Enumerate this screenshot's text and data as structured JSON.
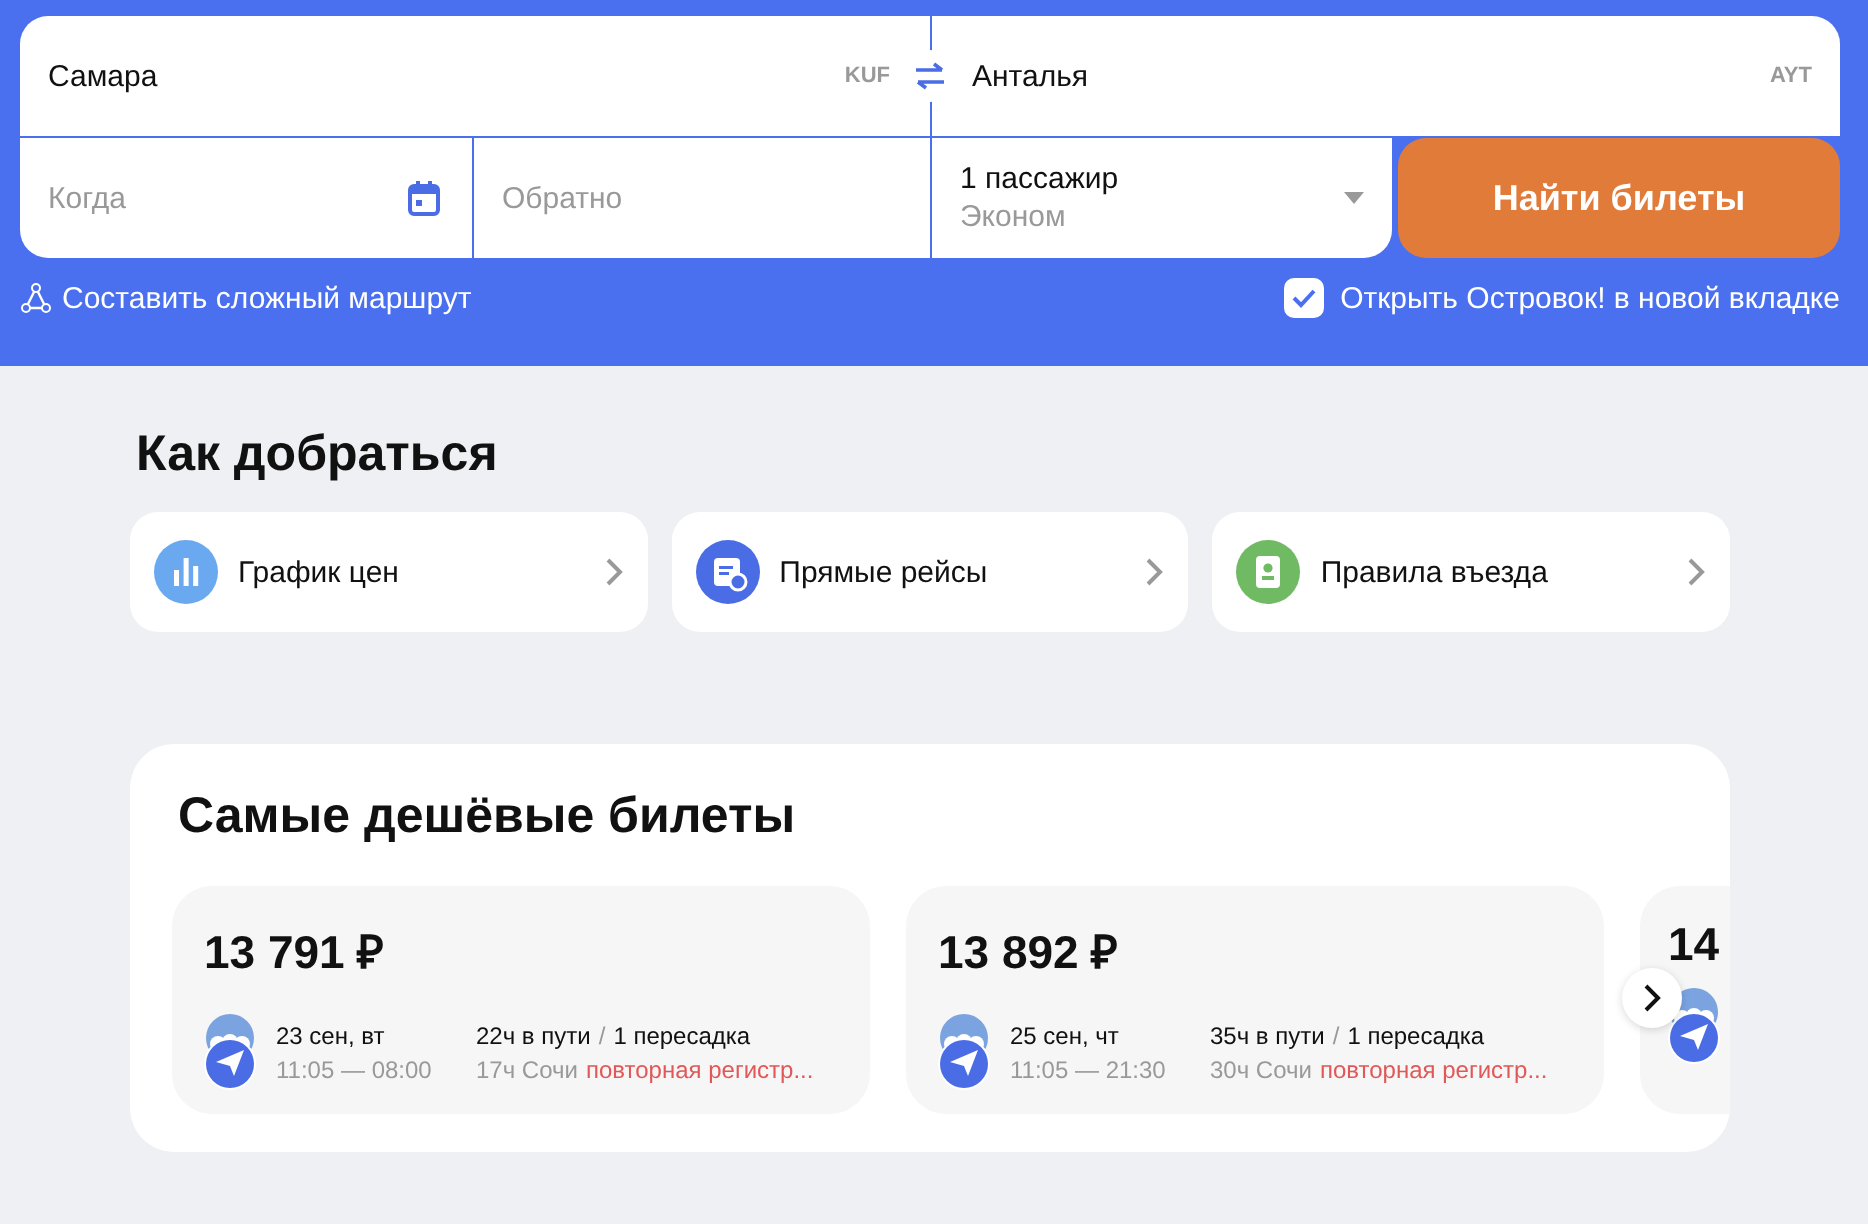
{
  "search": {
    "from": {
      "value": "Самара",
      "code": "KUF"
    },
    "to": {
      "value": "Анталья",
      "code": "AYT"
    },
    "depart": {
      "placeholder": "Когда"
    },
    "return": {
      "placeholder": "Обратно"
    },
    "passengers": {
      "count": "1 пассажир",
      "class": "Эконом"
    },
    "submit": "Найти билеты",
    "complex_route": "Составить сложный маршрут",
    "new_tab": {
      "label": "Открыть Островок! в новой вкладке",
      "checked": true
    }
  },
  "how_to_get": {
    "title": "Как добраться",
    "links": [
      {
        "kind": "chart",
        "label": "График цен",
        "color": "#6aa9ef"
      },
      {
        "kind": "calendar",
        "label": "Прямые рейсы",
        "color": "#4a6de5"
      },
      {
        "kind": "passport",
        "label": "Правила въезда",
        "color": "#6fba62"
      }
    ]
  },
  "cheapest": {
    "title": "Самые дешёвые билеты",
    "tickets": [
      {
        "kind": "full",
        "price": "13 791 ₽",
        "date": "23 сен, вт",
        "dep": "11:05",
        "dash": "—",
        "arr": "08:00",
        "duration": "22ч в пути",
        "slash": "/",
        "transfers": "1 пересадка",
        "layover": "17ч Сочи",
        "note": "повторная регистр..."
      },
      {
        "kind": "full",
        "price": "13 892 ₽",
        "date": "25 сен, чт",
        "dep": "11:05",
        "dash": "—",
        "arr": "21:30",
        "duration": "35ч в пути",
        "slash": "/",
        "transfers": "1 пересадка",
        "layover": "30ч Сочи",
        "note": "повторная регистр..."
      },
      {
        "kind": "partial",
        "price": "14"
      }
    ]
  }
}
